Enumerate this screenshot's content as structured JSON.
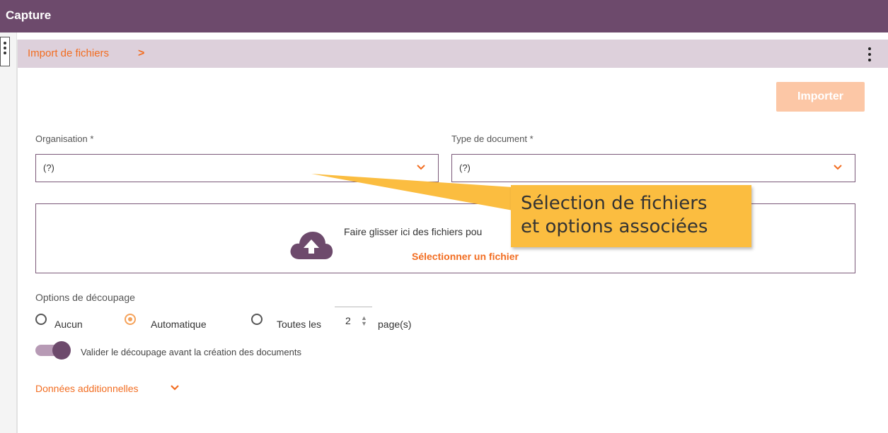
{
  "app": {
    "title": "Capture"
  },
  "panel": {
    "breadcrumb": "Import de fichiers"
  },
  "toolbar": {
    "import_label": "Importer"
  },
  "form": {
    "organisation": {
      "label": "Organisation *",
      "value": "(?)"
    },
    "document_type": {
      "label": "Type de document *",
      "value": "(?)"
    }
  },
  "dropzone": {
    "text": "Faire glisser ici des fichiers pou",
    "select_link": "Sélectionner un fichier",
    "icon": "cloud-upload-icon"
  },
  "split_options": {
    "title": "Options de découpage",
    "none_label": "Aucun",
    "auto_label": "Automatique",
    "every_label": "Toutes les",
    "pages_value": "2",
    "pages_suffix": "page(s)",
    "selected": "Automatique"
  },
  "validate_toggle": {
    "label": "Valider le découpage avant la création des documents",
    "on": true
  },
  "additional_data": {
    "label": "Données additionnelles"
  },
  "annotation": {
    "text": "Sélection de fichiers\net options associées"
  },
  "colors": {
    "brand": "#6d4a6c",
    "accent": "#f26d21",
    "callout": "#fbbd40"
  }
}
